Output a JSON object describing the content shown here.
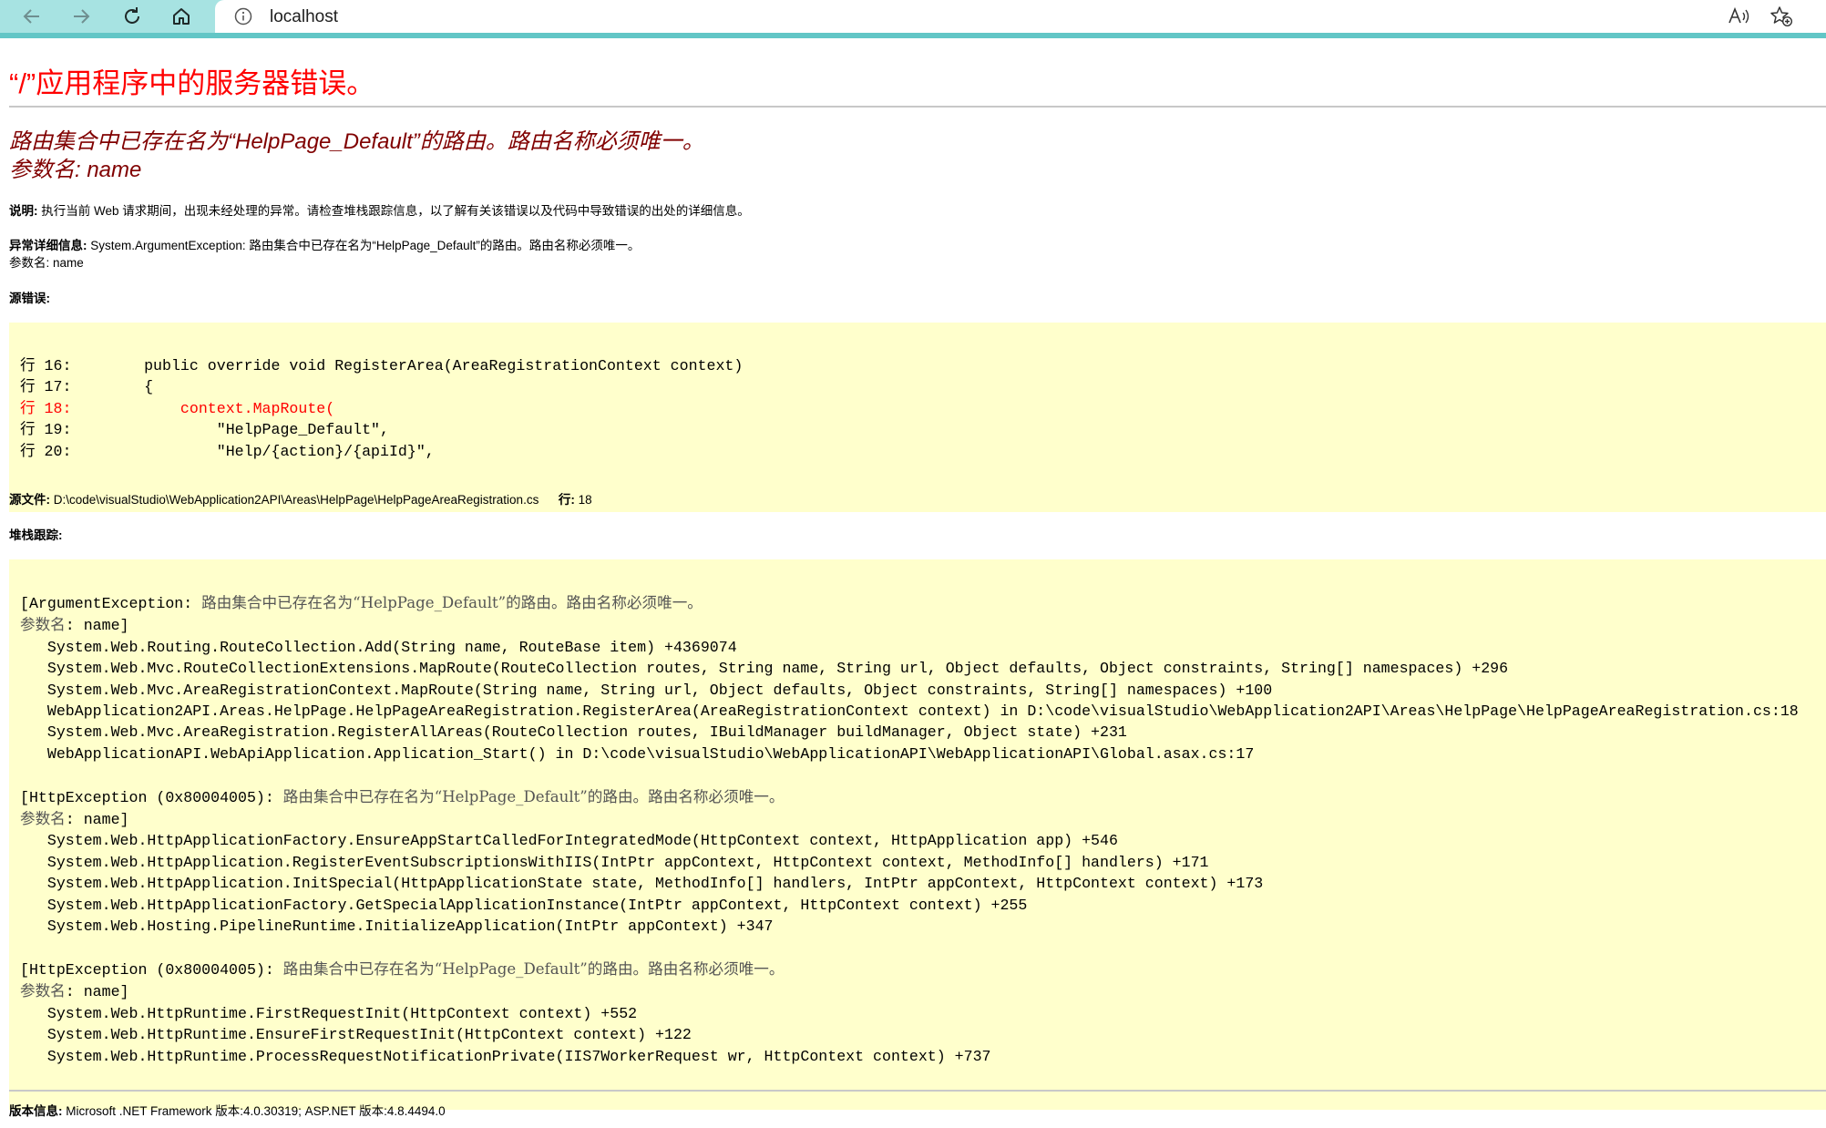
{
  "browser": {
    "url": "localhost"
  },
  "page": {
    "title": "“/”应用程序中的服务器错误。",
    "error_message_line1": "路由集合中已存在名为“HelpPage_Default”的路由。路由名称必须唯一。",
    "error_message_line2": "参数名: name",
    "description_label": "说明:",
    "description_text": "执行当前 Web 请求期间，出现未经处理的异常。请检查堆栈跟踪信息，以了解有关该错误以及代码中导致错误的出处的详细信息。",
    "exception_label": "异常详细信息:",
    "exception_text": "System.ArgumentException: 路由集合中已存在名为“HelpPage_Default”的路由。路由名称必须唯一。",
    "exception_param": "参数名: name",
    "source_error_label": "源错误:",
    "source_lines": [
      {
        "label": "行 16:",
        "code": "        public override void RegisterArea(AreaRegistrationContext context)",
        "highlight": false
      },
      {
        "label": "行 17:",
        "code": "        {",
        "highlight": false
      },
      {
        "label": "行 18:",
        "code": "            context.MapRoute(",
        "highlight": true
      },
      {
        "label": "行 19:",
        "code": "                \"HelpPage_Default\",",
        "highlight": false
      },
      {
        "label": "行 20:",
        "code": "                \"Help/{action}/{apiId}\",",
        "highlight": false
      }
    ],
    "source_file_label": "源文件:",
    "source_file_path": "D:\\code\\visualStudio\\WebApplication2API\\Areas\\HelpPage\\HelpPageAreaRegistration.cs",
    "line_label": "行:",
    "line_number": "18",
    "stack_trace_label": "堆栈跟踪:",
    "stack_blocks": [
      {
        "header_pre": "[ArgumentException: ",
        "header_msg": "路由集合中已存在名为“HelpPage_Default”的路由。路由名称必须唯一。",
        "param_pre": "参数名",
        "param_post": ": name]",
        "frames": [
          "   System.Web.Routing.RouteCollection.Add(String name, RouteBase item) +4369074",
          "   System.Web.Mvc.RouteCollectionExtensions.MapRoute(RouteCollection routes, String name, String url, Object defaults, Object constraints, String[] namespaces) +296",
          "   System.Web.Mvc.AreaRegistrationContext.MapRoute(String name, String url, Object defaults, Object constraints, String[] namespaces) +100",
          "   WebApplication2API.Areas.HelpPage.HelpPageAreaRegistration.RegisterArea(AreaRegistrationContext context) in D:\\code\\visualStudio\\WebApplication2API\\Areas\\HelpPage\\HelpPageAreaRegistration.cs:18",
          "   System.Web.Mvc.AreaRegistration.RegisterAllAreas(RouteCollection routes, IBuildManager buildManager, Object state) +231",
          "   WebApplicationAPI.WebApiApplication.Application_Start() in D:\\code\\visualStudio\\WebApplicationAPI\\WebApplicationAPI\\Global.asax.cs:17"
        ]
      },
      {
        "header_pre": "[HttpException (0x80004005): ",
        "header_msg": "路由集合中已存在名为“HelpPage_Default”的路由。路由名称必须唯一。",
        "param_pre": "参数名",
        "param_post": ": name]",
        "frames": [
          "   System.Web.HttpApplicationFactory.EnsureAppStartCalledForIntegratedMode(HttpContext context, HttpApplication app) +546",
          "   System.Web.HttpApplication.RegisterEventSubscriptionsWithIIS(IntPtr appContext, HttpContext context, MethodInfo[] handlers) +171",
          "   System.Web.HttpApplication.InitSpecial(HttpApplicationState state, MethodInfo[] handlers, IntPtr appContext, HttpContext context) +173",
          "   System.Web.HttpApplicationFactory.GetSpecialApplicationInstance(IntPtr appContext, HttpContext context) +255",
          "   System.Web.Hosting.PipelineRuntime.InitializeApplication(IntPtr appContext) +347"
        ]
      },
      {
        "header_pre": "[HttpException (0x80004005): ",
        "header_msg": "路由集合中已存在名为“HelpPage_Default”的路由。路由名称必须唯一。",
        "param_pre": "参数名",
        "param_post": ": name]",
        "frames": [
          "   System.Web.HttpRuntime.FirstRequestInit(HttpContext context) +552",
          "   System.Web.HttpRuntime.EnsureFirstRequestInit(HttpContext context) +122",
          "   System.Web.HttpRuntime.ProcessRequestNotificationPrivate(IIS7WorkerRequest wr, HttpContext context) +737"
        ]
      }
    ],
    "version_label": "版本信息:",
    "version_text": "Microsoft .NET Framework 版本:4.0.30319; ASP.NET 版本:4.8.4494.0"
  },
  "colors": {
    "toolbar": "#a7e3e2",
    "title": "#ff0000",
    "error_message": "#800000",
    "code_background": "#ffffcc"
  }
}
